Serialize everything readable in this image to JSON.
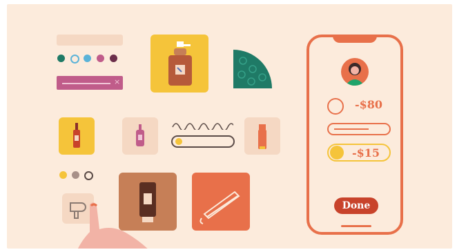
{
  "phone": {
    "price_one": "-$80",
    "price_two": "-$15",
    "done_label": "Done"
  },
  "colors": {
    "background": "#fcebdc",
    "accent_orange": "#e8704a",
    "done_red": "#c8432b",
    "yellow": "#f5c43a",
    "teal": "#1f7a66",
    "pink_bar": "#c05c8a",
    "brown": "#c67f57"
  },
  "icons": [
    "color-swatch-icon",
    "soap-bottle-icon",
    "serum-bottle-icon",
    "lipstick-icon",
    "hair-dryer-icon",
    "tube-icon",
    "hair-straightener-icon",
    "avatar-icon"
  ]
}
